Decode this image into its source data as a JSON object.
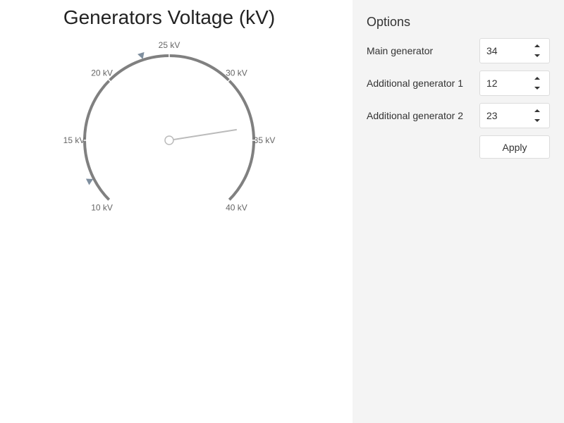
{
  "gauge": {
    "title": "Generators Voltage (kV)",
    "unit": "kV",
    "min": 10,
    "max": 40,
    "major_ticks": [
      10,
      15,
      20,
      25,
      30,
      35,
      40
    ],
    "tick_labels": [
      "10 kV",
      "15 kV",
      "20 kV",
      "25 kV",
      "30 kV",
      "35 kV",
      "40 kV"
    ],
    "needle_value": 34,
    "markers": [
      {
        "value": 12,
        "color": "#7f8f9f"
      },
      {
        "value": 23,
        "color": "#7f8f9f"
      }
    ],
    "colors": {
      "scale": "#808080",
      "needle": "#bbbbbb",
      "hub_stroke": "#bbbbbb"
    }
  },
  "options": {
    "title": "Options",
    "fields": [
      {
        "label": "Main generator",
        "value": "34"
      },
      {
        "label": "Additional generator 1",
        "value": "12"
      },
      {
        "label": "Additional generator 2",
        "value": "23"
      }
    ],
    "apply_label": "Apply"
  }
}
